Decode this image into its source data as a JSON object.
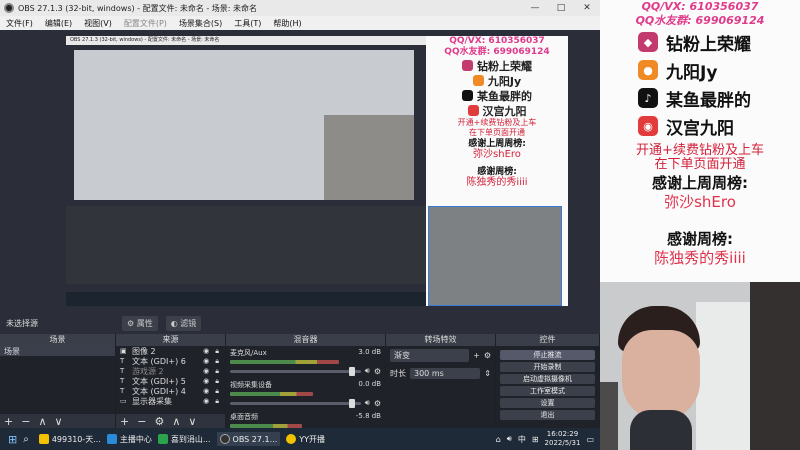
{
  "window": {
    "title": "OBS 27.1.3 (32-bit, windows) - 配置文件: 未命名 - 场景: 未命名",
    "controls": [
      "—",
      "□",
      "✕"
    ]
  },
  "menu": [
    "文件(F)",
    "编辑(E)",
    "视图(V)",
    "配置文件(P)",
    "场景集合(S)",
    "工具(T)",
    "帮助(H)"
  ],
  "preview": {
    "panel": {
      "qq": "QQ/VX: 610356037",
      "qq_fans": "QQ水友群: 699069124",
      "rows": [
        {
          "label": "钻粉上荣耀",
          "color": "#c23a6e"
        },
        {
          "label": "九阳Jy",
          "color": "#f08a24"
        },
        {
          "label": "某鱼最胖的",
          "color": "#111111"
        },
        {
          "label": "汉宫九阳",
          "color": "#e13b3b"
        }
      ],
      "promo": "开通+续费钻粉及上车\n在下单页面开通",
      "week_top": "感谢上周周榜:",
      "week_top_name": "弥沙shEro",
      "week": "感谢周榜:",
      "week_name": "陈独秀的秀iiii"
    }
  },
  "scene_bar": {
    "label": "未选择源",
    "properties": "属性",
    "filters": "滤镜"
  },
  "docks": {
    "scenes": {
      "title": "场景",
      "items": [
        "场景"
      ]
    },
    "sources": {
      "title": "来源",
      "items": [
        {
          "icon": "image-icon",
          "glyph": "▣",
          "label": "图像 2"
        },
        {
          "icon": "text-icon",
          "glyph": "T",
          "label": "文本 (GDI+) 6"
        },
        {
          "icon": "text-icon",
          "glyph": "T",
          "label": "游戏源 2"
        },
        {
          "icon": "text-icon",
          "glyph": "T",
          "label": "文本 (GDI+) 5"
        },
        {
          "icon": "text-icon",
          "glyph": "T",
          "label": "文本 (GDI+) 4"
        },
        {
          "icon": "monitor-icon",
          "glyph": "▭",
          "label": "显示器采集"
        }
      ]
    },
    "mixer": {
      "title": "混音器",
      "tracks": [
        {
          "name": "麦克风/Aux",
          "db": "3.0 dB",
          "level": 0.72
        },
        {
          "name": "视频采集设备",
          "db": "0.0 dB",
          "level": 0.55
        },
        {
          "name": "桌面音频",
          "db": "-5.8 dB",
          "level": 0.48
        }
      ]
    },
    "transitions": {
      "title": "转场特效",
      "type": "渐变",
      "duration_label": "时长",
      "duration_value": "300 ms"
    },
    "controls": {
      "title": "控件",
      "buttons": [
        "停止推流",
        "开始录制",
        "启动虚拟摄像机",
        "工作室模式",
        "设置",
        "退出"
      ]
    }
  },
  "taskbar": {
    "apps": [
      {
        "label": "499310-天...",
        "color": "#f2c200"
      },
      {
        "label": "主播中心",
        "color": "#2a8cd8"
      },
      {
        "label": "喜到涓山...",
        "color": "#2ba34a"
      },
      {
        "label": "OBS 27.1...",
        "color": "#333333"
      },
      {
        "label": "YY开播",
        "color": "#f2c200"
      }
    ],
    "ime": "中",
    "time": "16:02:29",
    "date": "2022/5/31"
  },
  "side": {
    "qq": "QQ/VX: 610356037",
    "qq_fans": "QQ水友群: 699069124",
    "rows": [
      {
        "label": "钻粉上荣耀",
        "color": "#c23a6e",
        "glyph": "◆"
      },
      {
        "label": "九阳Jy",
        "color": "#f08a24",
        "glyph": "●"
      },
      {
        "label": "某鱼最胖的",
        "color": "#111111",
        "glyph": "♪"
      },
      {
        "label": "汉宫九阳",
        "color": "#e13b3b",
        "glyph": "◉"
      }
    ],
    "promo_line1": "开通+续费钻粉及上车",
    "promo_line2": "在下单页面开通",
    "week_top": "感谢上周周榜:",
    "week_top_name": "弥沙shEro",
    "week": "感谢周榜:",
    "week_name": "陈独秀的秀iiii"
  },
  "colors": {
    "accent": "#3a7bd5",
    "pink": "#e03a8a",
    "red": "#d3213a"
  }
}
